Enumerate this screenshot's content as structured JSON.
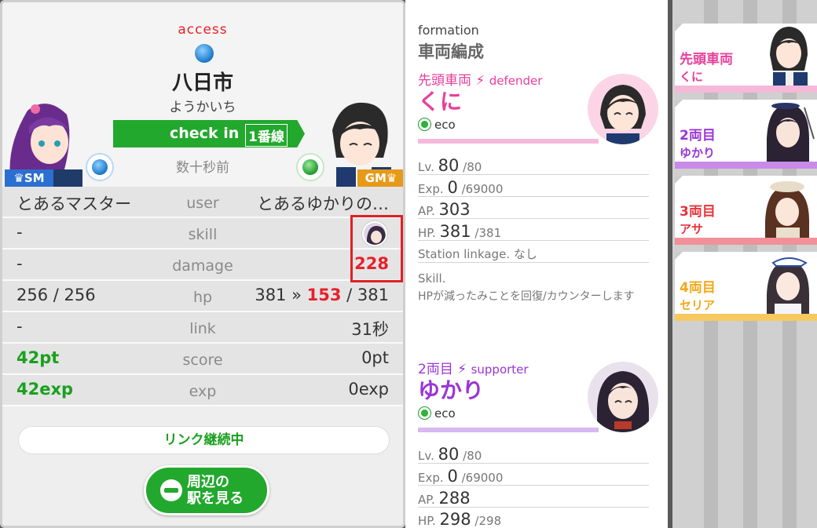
{
  "checkin": {
    "access_label": "access",
    "station_name": "八日市",
    "station_kana": "ようかいち",
    "checkin_text": "check in",
    "line_label": "1番線",
    "time_ago": "数十秒前",
    "badge_left": "♛SM",
    "badge_right": "GM♛"
  },
  "stats": {
    "user": {
      "left": "とあるマスター",
      "label": "user",
      "right": "とあるゆかりの…"
    },
    "skill": {
      "left": "-",
      "label": "skill"
    },
    "damage": {
      "left": "-",
      "label": "damage",
      "right": "228"
    },
    "hp": {
      "left": "256 / 256",
      "label": "hp",
      "right_before": "381 »",
      "right_now": "153",
      "right_after": "/ 381"
    },
    "link": {
      "left": "-",
      "label": "link",
      "right": "31秒"
    },
    "score": {
      "left": "42pt",
      "label": "score",
      "right": "0pt"
    },
    "exp": {
      "left": "42exp",
      "label": "exp",
      "right": "0exp"
    }
  },
  "link_status": "リンク継続中",
  "nearby_button": {
    "line1": "周辺の",
    "line2": "駅を見る"
  },
  "formation": {
    "label": "formation",
    "title": "車両編成",
    "cars": [
      {
        "position": "先頭車両",
        "role": "defender",
        "name": "くに",
        "attribute": "eco",
        "color": "#e83f9a",
        "bar_color": "#f6b8d8",
        "lv_label": "Lv.",
        "lv": "80",
        "lv_max": "/80",
        "exp_label": "Exp.",
        "exp": "0",
        "exp_max": "/69000",
        "ap_label": "AP.",
        "ap": "303",
        "hp_label": "HP.",
        "hp": "381",
        "hp_max": "/381",
        "linkage_label": "Station linkage.",
        "linkage": "なし",
        "skill_label": "Skill.",
        "skill_desc": "HPが減ったみことを回復/カウンターします"
      },
      {
        "position": "2両目",
        "role": "supporter",
        "name": "ゆかり",
        "attribute": "eco",
        "color": "#9b35d6",
        "bar_color": "#d7b8f0",
        "lv_label": "Lv.",
        "lv": "80",
        "lv_max": "/80",
        "exp_label": "Exp.",
        "exp": "0",
        "exp_max": "/69000",
        "ap_label": "AP.",
        "ap": "288",
        "hp_label": "HP.",
        "hp": "298",
        "hp_max": "/298"
      }
    ]
  },
  "sidebar_cards": [
    {
      "line1": "先頭車両",
      "line2": "くに",
      "color": "#e83f9a"
    },
    {
      "line1": "2両目",
      "line2": "ゆかり",
      "color": "#9b35d6"
    },
    {
      "line1": "3両目",
      "line2": "アサ",
      "color": "#e8333a"
    },
    {
      "line1": "4両目",
      "line2": "セリア",
      "color": "#f2a818"
    }
  ]
}
